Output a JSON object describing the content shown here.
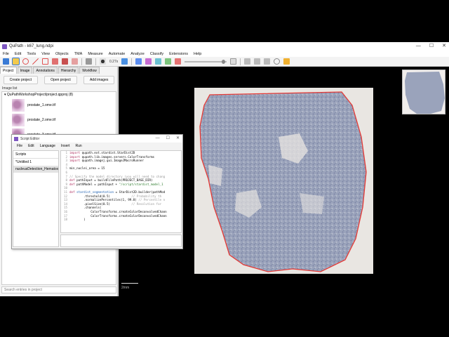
{
  "window": {
    "title": "QuPath - k67_lung.ndpi",
    "min": "—",
    "max": "☐",
    "close": "✕"
  },
  "menu": [
    "File",
    "Edit",
    "Tools",
    "View",
    "Objects",
    "TMA",
    "Measure",
    "Automate",
    "Analyze",
    "Classify",
    "Extensions",
    "Help"
  ],
  "toolbar": {
    "zoom_label": "0.27x"
  },
  "tabs": [
    "Project",
    "Image",
    "Annotations",
    "Hierarchy",
    "Workflow"
  ],
  "project": {
    "create_label": "Create project",
    "open_label": "Open project",
    "add_label": "Add images",
    "image_list_label": "Image list",
    "root_label": "QuPathWorkshopProject/project.qpproj (8)",
    "images": [
      "prostate_1.ome.tif",
      "prostate_2.ome.tif",
      "prostate_3.ome.tif"
    ],
    "search_placeholder": "Search entries in project"
  },
  "editor": {
    "title": "Script Editor",
    "menu": [
      "File",
      "Edit",
      "Language",
      "Insert",
      "Run"
    ],
    "scripts_header": "Scripts",
    "scripts": [
      "*Untitled 1",
      "nucleusDetection_Hematox"
    ],
    "code_lines": [
      {
        "n": "1",
        "t": [
          [
            "kw",
            "import "
          ],
          [
            "",
            "qupath.ext.stardist.StarDist2D"
          ]
        ]
      },
      {
        "n": "2",
        "t": [
          [
            "kw",
            "import "
          ],
          [
            "",
            "qupath.lib.images.servers.ColorTransforms"
          ]
        ]
      },
      {
        "n": "3",
        "t": [
          [
            "kw",
            "import "
          ],
          [
            "",
            "qupath.imagej.gui.ImageJMacroRunner"
          ]
        ]
      },
      {
        "n": "4",
        "t": [
          [
            "",
            ""
          ]
        ]
      },
      {
        "n": "5",
        "t": [
          [
            "",
            "min_nuclei_area = 15"
          ]
        ]
      },
      {
        "n": "6",
        "t": [
          [
            "",
            ""
          ]
        ]
      },
      {
        "n": "7",
        "t": [
          [
            "cm",
            "// Specify the model directory (you will need to chang"
          ]
        ]
      },
      {
        "n": "8",
        "t": [
          [
            "kw",
            "def "
          ],
          [
            "",
            "pathInput = buildFilePath(PROJECT_BASE_DIR)"
          ]
        ]
      },
      {
        "n": "9",
        "t": [
          [
            "kw",
            "def "
          ],
          [
            "",
            "pathModel = pathInput + "
          ],
          [
            "str",
            "\"/script/stardist_model_1"
          ]
        ]
      },
      {
        "n": "10",
        "t": [
          [
            "",
            ""
          ]
        ]
      },
      {
        "n": "11",
        "t": [
          [
            "kw",
            "def "
          ],
          [
            "nm",
            "stardist_segmentation"
          ],
          [
            "",
            " = StarDist2D.builder(pathMod"
          ]
        ]
      },
      {
        "n": "12",
        "t": [
          [
            "",
            "        .threshold(0.5)            "
          ],
          [
            "cm",
            "// Probability th"
          ]
        ]
      },
      {
        "n": "13",
        "t": [
          [
            "",
            "        .normalizePercentiles(1, 99.8) "
          ],
          [
            "cm",
            "// Percentile n"
          ]
        ]
      },
      {
        "n": "14",
        "t": [
          [
            "",
            "        .pixelSize(0.5)            "
          ],
          [
            "cm",
            "// Resolution for"
          ]
        ]
      },
      {
        "n": "15",
        "t": [
          [
            "",
            "        .channels("
          ]
        ]
      },
      {
        "n": "16",
        "t": [
          [
            "",
            "            ColorTransforms.createColorDeconvolvedChann"
          ]
        ]
      },
      {
        "n": "17",
        "t": [
          [
            "",
            "            ColorTransforms.createColorDeconvolvedChann"
          ]
        ]
      },
      {
        "n": "18",
        "t": [
          [
            "",
            "        )"
          ]
        ]
      }
    ]
  },
  "viewer": {
    "scale_label": "2mm",
    "annotation_color": "#e53935"
  }
}
